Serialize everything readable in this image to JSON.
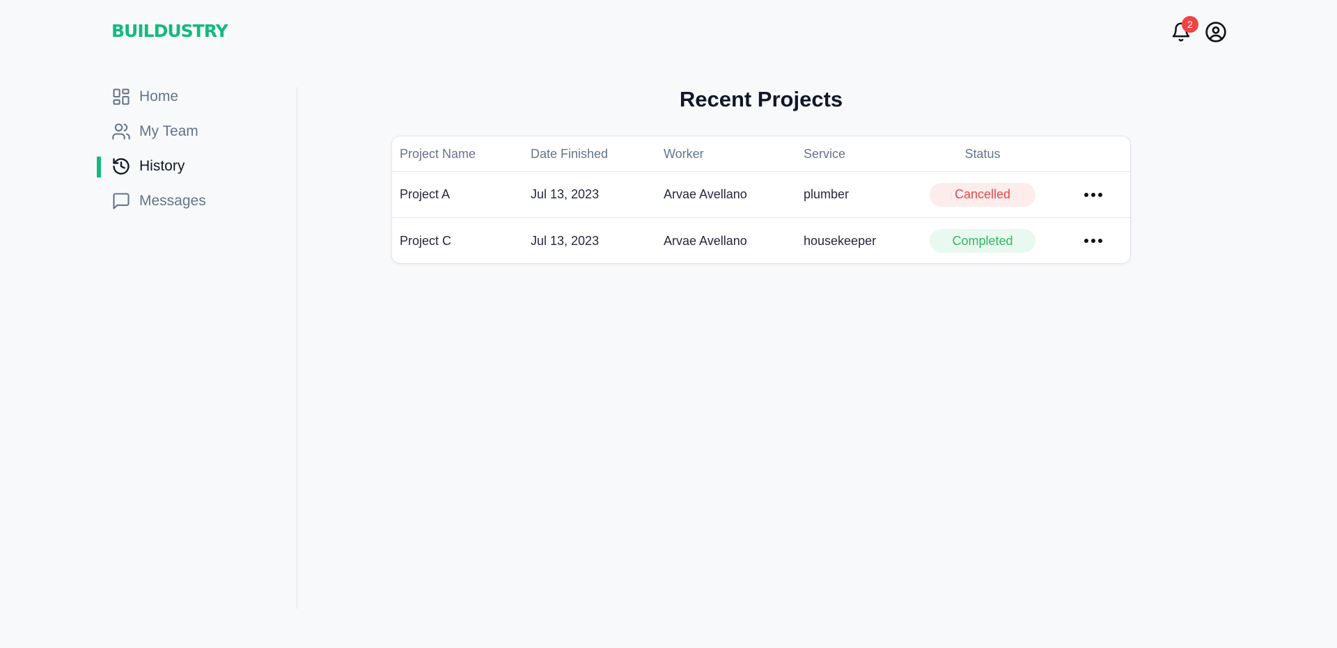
{
  "header": {
    "logo": "BUILDUSTRY",
    "notification_count": "2"
  },
  "sidebar": {
    "items": [
      {
        "label": "Home",
        "icon": "dashboard-icon",
        "active": false
      },
      {
        "label": "My Team",
        "icon": "users-icon",
        "active": false
      },
      {
        "label": "History",
        "icon": "history-icon",
        "active": true
      },
      {
        "label": "Messages",
        "icon": "message-icon",
        "active": false
      }
    ]
  },
  "main": {
    "title": "Recent Projects",
    "table": {
      "columns": [
        "Project Name",
        "Date Finished",
        "Worker",
        "Service",
        "Status"
      ],
      "rows": [
        {
          "project": "Project A",
          "date": "Jul 13, 2023",
          "worker": "Arvae Avellano",
          "service": "plumber",
          "status": "Cancelled"
        },
        {
          "project": "Project C",
          "date": "Jul 13, 2023",
          "worker": "Arvae Avellano",
          "service": "housekeeper",
          "status": "Completed"
        }
      ]
    }
  },
  "colors": {
    "brand": "#16b97a",
    "badge": "#ef4444",
    "cancelled_bg": "#fdecec",
    "cancelled_text": "#e14b4b",
    "completed_bg": "#e9f9ef",
    "completed_text": "#2fb463"
  }
}
